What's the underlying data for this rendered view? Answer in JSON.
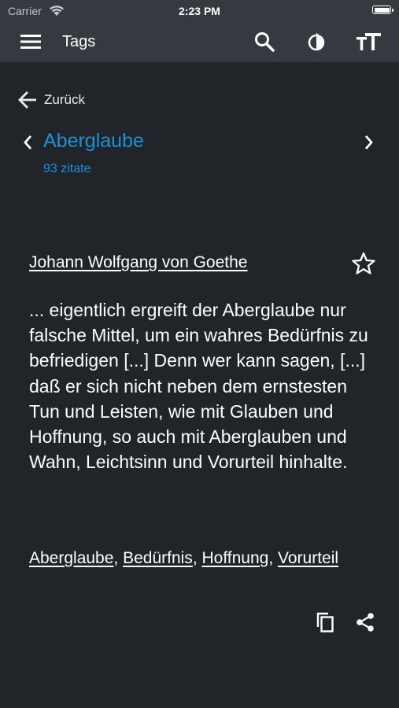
{
  "status_bar": {
    "carrier": "Carrier",
    "time": "2:23 PM"
  },
  "app_bar": {
    "title": "Tags",
    "icons": {
      "menu": "hamburger-menu-icon",
      "search": "search-icon",
      "contrast": "contrast-icon",
      "text_size": "text-size-icon"
    }
  },
  "nav": {
    "back_label": "Zurück"
  },
  "tag": {
    "name": "Aberglaube",
    "count": "93 zitate"
  },
  "quote": {
    "author": "Johann Wolfgang von Goethe",
    "text": "... eigentlich ergreift der Aberglaube nur falsche Mittel, um ein wahres Bedürfnis zu befriedigen [...] Denn wer kann sagen, [...] daß er sich nicht neben dem ernstesten Tun und Leisten, wie mit Glauben und Hoffnung, so auch mit Aberglauben und Wahn, Leichtsinn und Vorurteil hinhalte.",
    "tags": [
      "Aberglaube",
      "Bedürfnis",
      "Hoffnung",
      "Vorurteil"
    ],
    "separator": ", "
  },
  "colors": {
    "background": "#212529",
    "app_bar": "#343a40",
    "accent": "#1e90d6",
    "text": "#ffffff"
  }
}
